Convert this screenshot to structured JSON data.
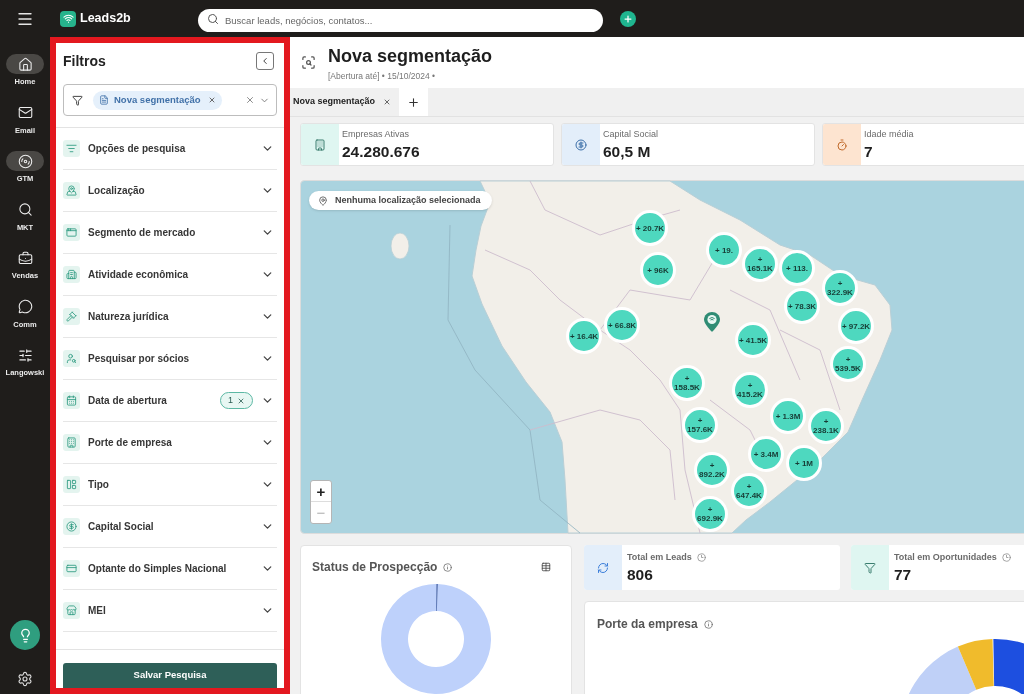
{
  "sidebar": {
    "items": [
      {
        "label": "Home",
        "selected": true
      },
      {
        "label": "Email",
        "selected": false
      },
      {
        "label": "GTM",
        "selected": true
      },
      {
        "label": "MKT",
        "selected": false
      },
      {
        "label": "Vendas",
        "selected": false
      },
      {
        "label": "Comm",
        "selected": false
      },
      {
        "label": "Langowski",
        "selected": false
      }
    ]
  },
  "top_bar": {
    "brand": "Leads2b",
    "search": {
      "placeholder": "Buscar leads, negócios, contatos..."
    }
  },
  "filters": {
    "title": "Filtros",
    "segment_select": {
      "tag": "Nova segmentação"
    },
    "sections": [
      {
        "label": "Opções de pesquisa"
      },
      {
        "label": "Localização"
      },
      {
        "label": "Segmento de mercado"
      },
      {
        "label": "Atividade econômica"
      },
      {
        "label": "Natureza jurídica"
      },
      {
        "label": "Pesquisar por sócios"
      },
      {
        "label": "Data de abertura",
        "count": "1"
      },
      {
        "label": "Porte de empresa"
      },
      {
        "label": "Tipo"
      },
      {
        "label": "Capital Social"
      },
      {
        "label": "Optante do Simples Nacional"
      },
      {
        "label": "MEI"
      }
    ],
    "save_button": "Salvar Pesquisa"
  },
  "page_header": {
    "title": "Nova segmentação",
    "subtitle": "[Abertura até] • 15/10/2024 •"
  },
  "tabs": [
    {
      "label": "Nova segmentação",
      "selected": true
    }
  ],
  "kpis": [
    {
      "label": "Empresas Ativas",
      "value": "24.280.676"
    },
    {
      "label": "Capital Social",
      "value": "60,5 M"
    },
    {
      "label": "Idade média",
      "value": "7"
    }
  ],
  "map": {
    "location_chip": "Nenhuma localização selecionada",
    "clusters": [
      "+ 20.7K",
      "+ 96K",
      "+ 19.",
      "+ 165.1K",
      "+ 113.",
      "+ 78.3K",
      "+ 322.9K",
      "+ 97.2K",
      "+ 539.5K",
      "+ 41.5K",
      "+ 66.8K",
      "+ 16.4K",
      "+ 158.5K",
      "+ 415.2K",
      "+ 1.3M",
      "+ 238.1K",
      "+ 157.6K",
      "+ 1M",
      "+ 3.4M",
      "+ 892.2K",
      "+ 647.4K",
      "+ 692.9K"
    ],
    "zoom_controls": [
      {
        "label": "+",
        "disabled": false
      },
      {
        "label": "−",
        "disabled": true
      }
    ]
  },
  "status_card": {
    "title": "Status de Prospecção"
  },
  "totals": [
    {
      "label": "Total em Leads",
      "value": "806"
    },
    {
      "label": "Total em Oportunidades",
      "value": "77"
    }
  ],
  "size_card": {
    "title": "Porte da empresa"
  }
}
